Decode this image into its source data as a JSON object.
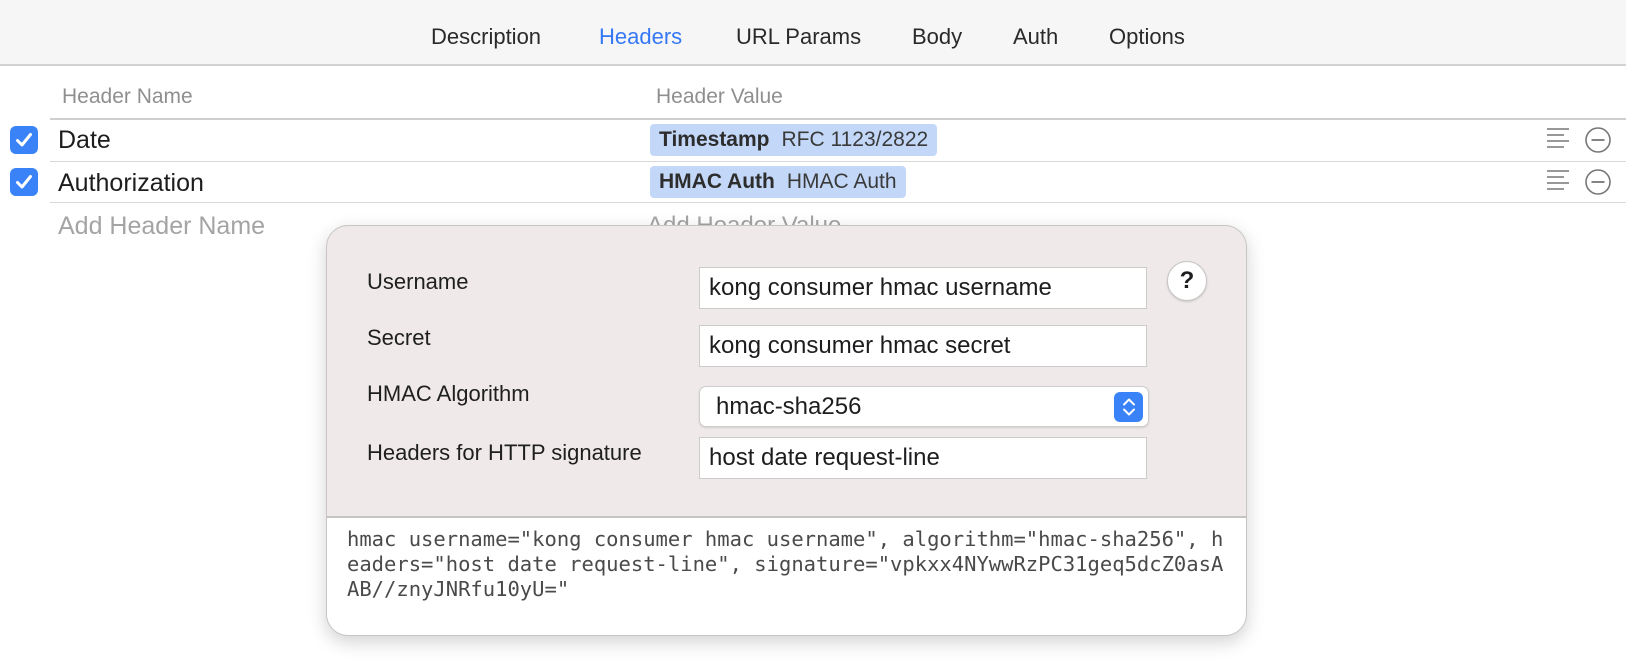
{
  "tabs": [
    {
      "label": "Description",
      "active": false
    },
    {
      "label": "Headers",
      "active": true
    },
    {
      "label": "URL Params",
      "active": false
    },
    {
      "label": "Body",
      "active": false
    },
    {
      "label": "Auth",
      "active": false
    },
    {
      "label": "Options",
      "active": false
    }
  ],
  "colors": {
    "accent": "#3478f6",
    "token_bg": "#c3d8f8",
    "popover_bg": "#efe9e9"
  },
  "table": {
    "columns": [
      "Header Name",
      "Header Value"
    ],
    "rows": [
      {
        "enabled": true,
        "name": "Date",
        "token_name": "Timestamp",
        "token_detail": "RFC 1123/2822"
      },
      {
        "enabled": true,
        "name": "Authorization",
        "token_name": "HMAC Auth",
        "token_detail": "HMAC Auth"
      }
    ],
    "add_name_placeholder": "Add Header Name",
    "add_value_placeholder": "Add Header Value"
  },
  "icons": {
    "checkbox": "checkmark-icon",
    "row_menu": "lines-icon",
    "row_remove": "minus-circle-icon",
    "select_stepper": "up-down-chevron-icon"
  },
  "hmac_popover": {
    "fields": {
      "username_label": "Username",
      "username_value": "kong consumer hmac username",
      "secret_label": "Secret",
      "secret_value": "kong consumer hmac secret",
      "algorithm_label": "HMAC Algorithm",
      "algorithm_value": "hmac-sha256",
      "headers_label": "Headers for HTTP signature",
      "headers_value": "host date request-line"
    },
    "help_label": "?",
    "preview": "hmac username=\"kong consumer hmac username\", algorithm=\"hmac-sha256\", headers=\"host date request-line\", signature=\"vpkxx4NYwwRzPC31geq5dcZ0asAAB//znyJNRfu10yU=\""
  }
}
